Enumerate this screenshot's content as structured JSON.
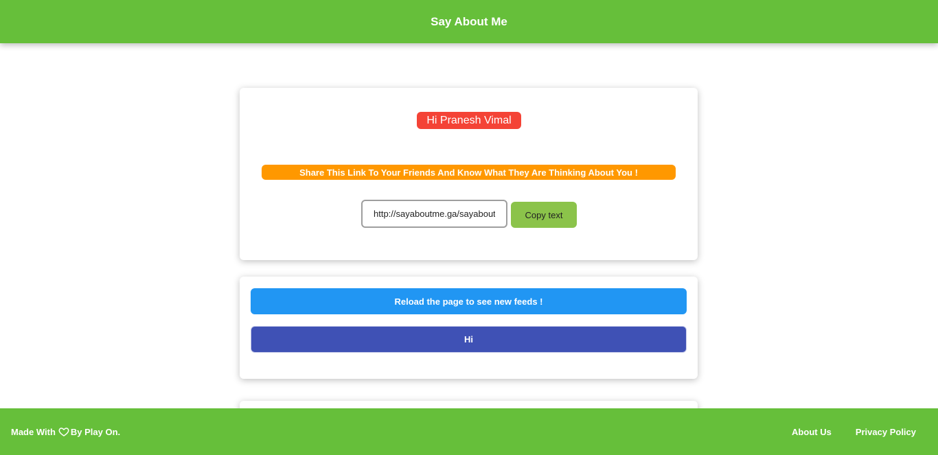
{
  "header": {
    "title": "Say About Me"
  },
  "profile": {
    "greeting": "Hi Pranesh Vimal",
    "share_message": "Share This Link To Your Friends And Know What They Are Thinking About You !",
    "link_value": "http://sayaboutme.ga/sayaboutme",
    "copy_label": "Copy text"
  },
  "feeds": {
    "reload_message": "Reload the page to see new feeds !",
    "items": [
      "Hi"
    ]
  },
  "footer": {
    "made_with_prefix": "Made With",
    "made_with_suffix": "By Play On.",
    "links": [
      "About Us",
      "Privacy Policy"
    ]
  },
  "colors": {
    "brand_green": "#66bf3a",
    "greeting_red": "#f44336",
    "banner_orange": "#ff9800",
    "copy_green": "#8bc34a",
    "reload_blue": "#2196f3",
    "feed_indigo": "#3f51b5"
  }
}
